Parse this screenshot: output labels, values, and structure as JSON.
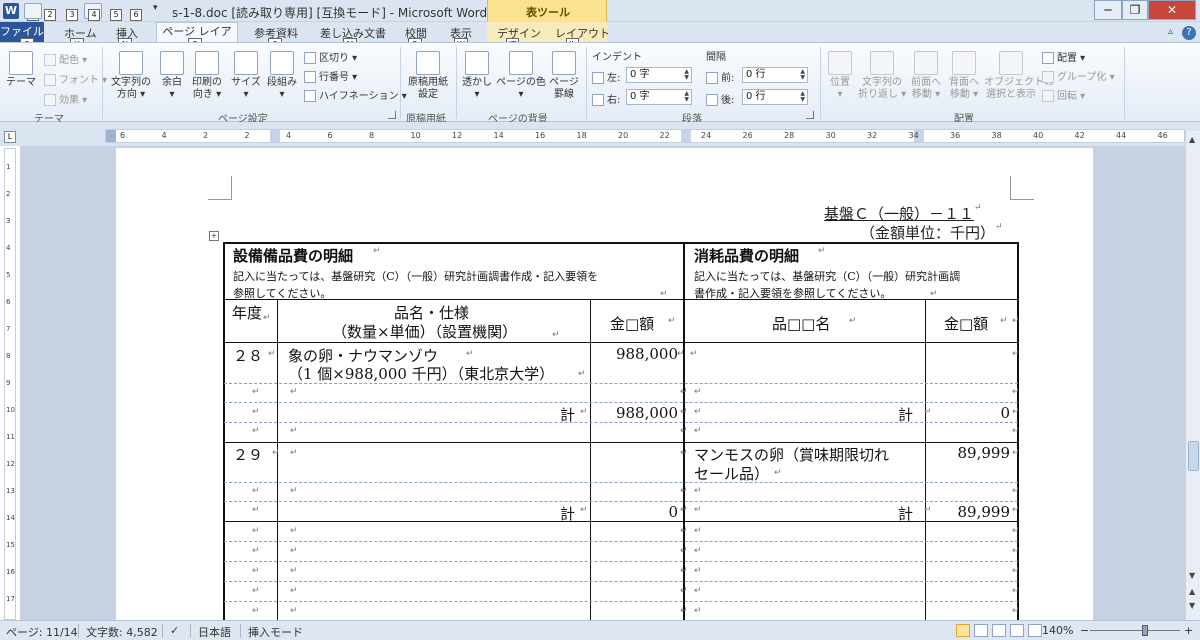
{
  "window": {
    "app_letter": "W",
    "title": "s-1-8.doc [読み取り専用] [互換モード] - Microsoft Word",
    "table_tools_label": "表ツール",
    "minimize": "─",
    "restore": "❐",
    "close": "✕",
    "qat_more": "▾"
  },
  "qat_keytips": [
    "1",
    "2",
    "3",
    "4",
    "5",
    "6"
  ],
  "tabs": {
    "file": "ファイル",
    "home": "ホーム",
    "insert": "挿入",
    "page_layout": "ページ レイアウト",
    "references": "参考資料",
    "mailings": "差し込み文書",
    "review": "校閲",
    "view": "表示",
    "design": "デザイン",
    "layout": "レイアウト"
  },
  "keytips": {
    "file": "F",
    "home": "H",
    "insert": "N",
    "page_layout": "P",
    "references": "S",
    "mailings": "M",
    "review": "R",
    "view": "W",
    "design": "JT",
    "layout": "JL"
  },
  "ribbon": {
    "theme_group": {
      "label": "テーマ",
      "theme_btn": "テーマ",
      "colors": "配色 ▾",
      "fonts": "フォント ▾",
      "effects": "効果 ▾"
    },
    "page_setup": {
      "label": "ページ設定",
      "text_direction": "文字列の",
      "text_direction2": "方向 ▾",
      "margins": "余白",
      "margins2": "▾",
      "orientation": "印刷の",
      "orientation2": "向き ▾",
      "size": "サイズ",
      "size2": "▾",
      "columns": "段組み",
      "columns2": "▾",
      "breaks": "区切り ▾",
      "line_numbers": "行番号 ▾",
      "hyphenation": "ハイフネーション ▾"
    },
    "manuscript": {
      "label": "原稿用紙",
      "btn": "原稿用紙",
      "btn2": "設定"
    },
    "page_background": {
      "label": "ページの背景",
      "watermark": "透かし",
      "watermark2": "▾",
      "page_color": "ページの色",
      "page_color2": "▾",
      "page_borders": "ページ",
      "page_borders2": "罫線"
    },
    "paragraph": {
      "label": "段落",
      "indent_title": "インデント",
      "left_label": "左:",
      "left_value": "0 字",
      "right_label": "右:",
      "right_value": "0 字",
      "spacing_title": "間隔",
      "before_label": "前:",
      "before_value": "0 行",
      "after_label": "後:",
      "after_value": "0 行"
    },
    "arrange": {
      "label": "配置",
      "position": "位置",
      "position2": "▾",
      "wrap": "文字列の",
      "wrap2": "折り返し ▾",
      "bring_forward": "前面へ",
      "bring_forward2": "移動 ▾",
      "send_backward": "背面へ",
      "send_backward2": "移動 ▾",
      "selection_pane": "オブジェクトの",
      "selection_pane2": "選択と表示",
      "align": "配置 ▾",
      "group": "グループ化 ▾",
      "rotate": "回転 ▾"
    }
  },
  "ruler_labels": [
    "6",
    "4",
    "2",
    "2",
    "4",
    "6",
    "8",
    "10",
    "12",
    "14",
    "16",
    "18",
    "20",
    "22",
    "24",
    "26",
    "28",
    "30",
    "32",
    "34",
    "36",
    "38",
    "40",
    "42",
    "44",
    "46"
  ],
  "vruler_labels": [
    "1",
    "2",
    "3",
    "4",
    "5",
    "6",
    "7",
    "8",
    "9",
    "10",
    "11",
    "12",
    "13",
    "14",
    "15",
    "16",
    "17"
  ],
  "document": {
    "header_code": "基盤Ｃ（一般）－１１",
    "unit": "（金額単位：千円）",
    "left_title": "設備備品費の明細",
    "left_note1": "記入に当たっては、基盤研究（C）（一般）研究計画調書作成・記入要領を",
    "left_note2": "参照してください。",
    "right_title": "消耗品費の明細",
    "right_note1": "記入に当たっては、基盤研究（C）（一般）研究計画調",
    "right_note2": "書作成・記入要領を参照してください。",
    "col_year": "年度",
    "col_item1": "品名・仕様",
    "col_item2": "（数量×単価）（設置機関）",
    "col_amount_left": "金□額",
    "col_item_right": "品□□名",
    "col_amount_right": "金□額",
    "rows": {
      "y28": "２８",
      "y28_item1": "象の卵・ナウマンゾウ",
      "y28_item2": "（1 個×988,000 千円）（東北京大学）",
      "y28_amount": "988,000",
      "y28_total_label": "計",
      "y28_total": "988,000",
      "y28_right_total_label": "計",
      "y28_right_total": "0",
      "y29": "２９",
      "y29_right_item1": "マンモスの卵（賞味期限切れ",
      "y29_right_item2": "セール品）",
      "y29_right_amount": "89,999",
      "y29_total_label": "計",
      "y29_total": "0",
      "y29_right_total_label": "計",
      "y29_right_total": "89,999"
    },
    "para_mark": "↵",
    "table_handle": "+"
  },
  "status": {
    "page": "ページ: 11/14",
    "words": "文字数: 4,582",
    "language": "日本語",
    "mode": "挿入モード",
    "zoom": "140%",
    "zoom_minus": "−",
    "zoom_plus": "+"
  },
  "colors": {
    "accent": "#2b579a",
    "table_tools": "#fae28f"
  }
}
